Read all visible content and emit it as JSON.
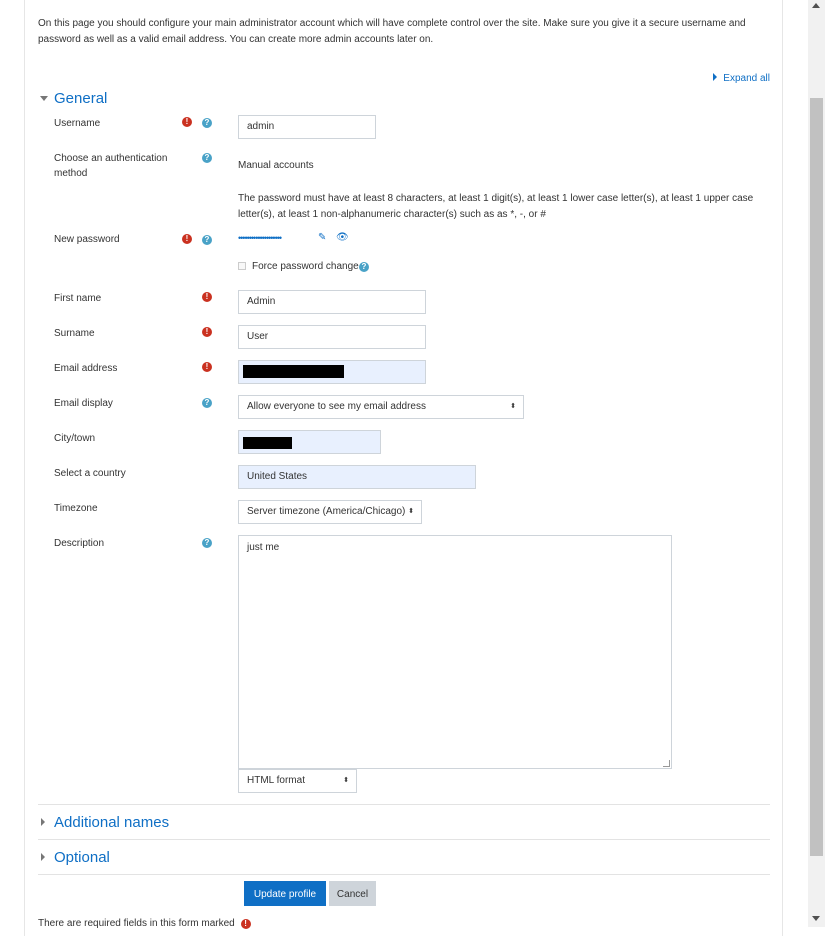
{
  "intro_text": "On this page you should configure your main administrator account which will have complete control over the site. Make sure you give it a secure username and password as well as a valid email address. You can create more admin accounts later on.",
  "expand_all": "Expand all",
  "sections": {
    "general": "General",
    "additional_names": "Additional names",
    "optional": "Optional"
  },
  "fields": {
    "username": {
      "label": "Username",
      "value": "admin"
    },
    "auth": {
      "label": "Choose an authentication method",
      "value": "Manual accounts"
    },
    "password_rules": "The password must have at least 8 characters, at least 1 digit(s), at least 1 lower case letter(s), at least 1 upper case letter(s), at least 1 non-alphanumeric character(s) such as as *, -, or #",
    "new_password": {
      "label": "New password",
      "masked": "••••••••••••••••••••"
    },
    "force_password_change": "Force password change",
    "first_name": {
      "label": "First name",
      "value": "Admin"
    },
    "surname": {
      "label": "Surname",
      "value": "User"
    },
    "email": {
      "label": "Email address"
    },
    "email_display": {
      "label": "Email display",
      "value": "Allow everyone to see my email address"
    },
    "city": {
      "label": "City/town"
    },
    "country": {
      "label": "Select a country",
      "value": "United States"
    },
    "timezone": {
      "label": "Timezone",
      "value": "Server timezone (America/Chicago)"
    },
    "description": {
      "label": "Description",
      "value": "just me",
      "format": "HTML format"
    }
  },
  "buttons": {
    "update": "Update profile",
    "cancel": "Cancel"
  },
  "footer_note": "There are required fields in this form marked",
  "icons": {
    "required": "!",
    "help": "?",
    "pencil": "✎",
    "eye": "👁",
    "select_arrows": "▲▼"
  },
  "colors": {
    "link": "#0f6fc5",
    "required": "#ca3120",
    "help": "#49a2c7",
    "autofill": "#e8f0fe"
  }
}
